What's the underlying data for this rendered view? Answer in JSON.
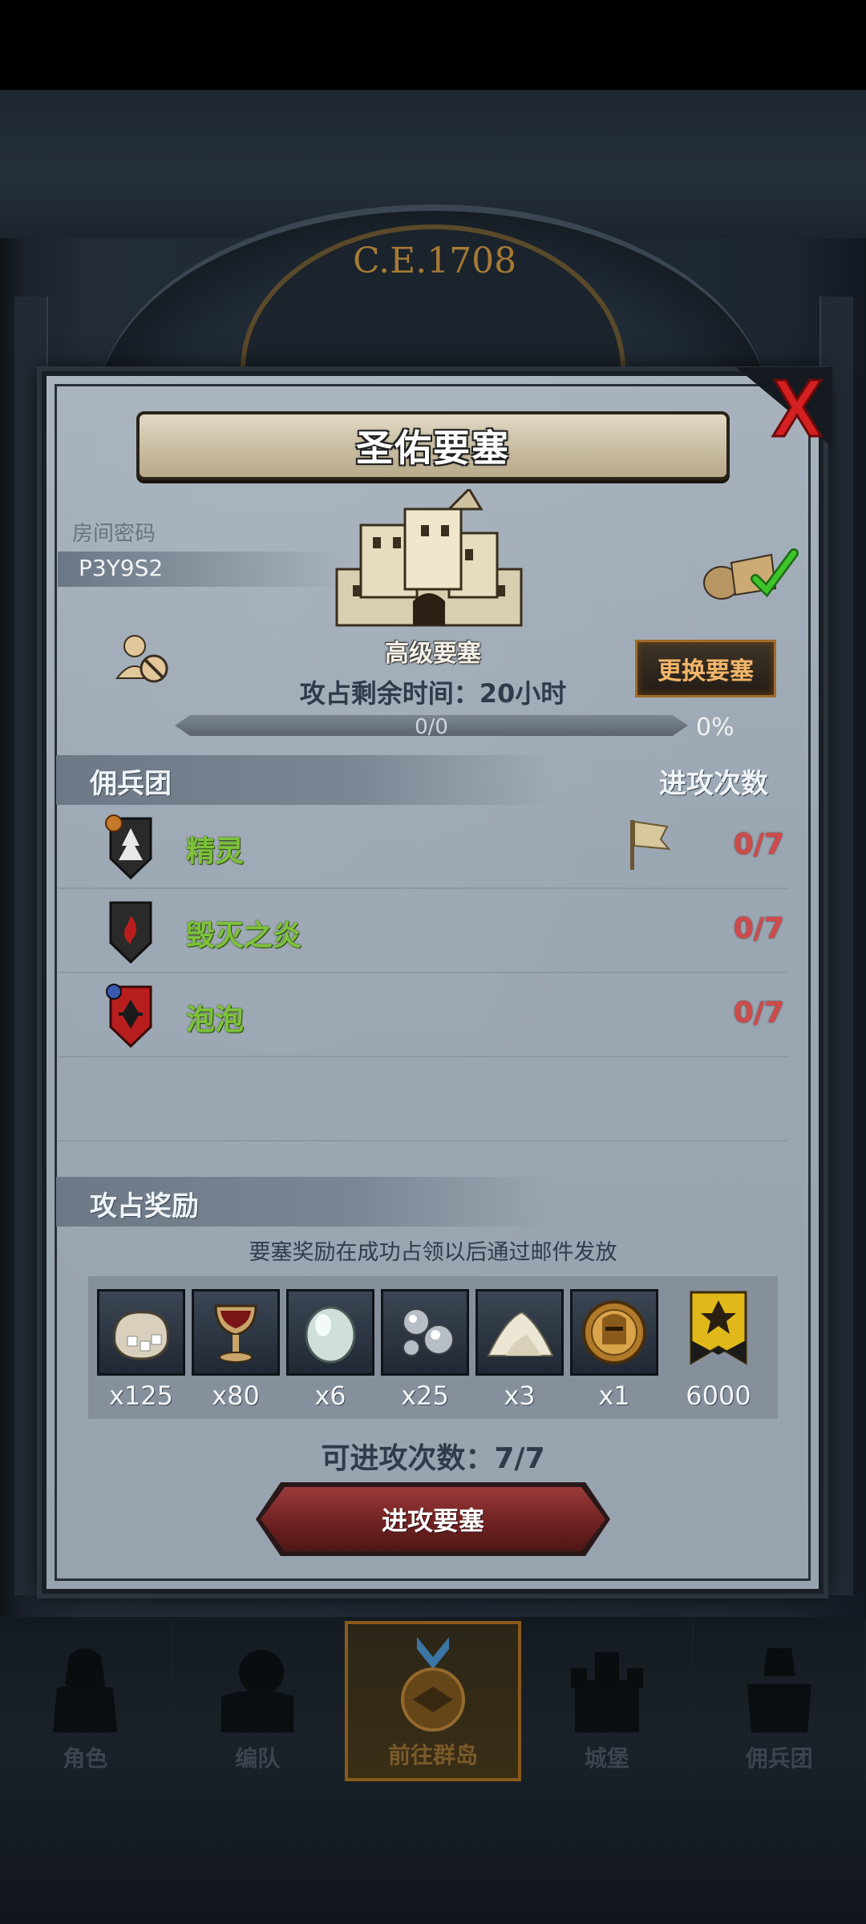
{
  "background": {
    "year": "C.E.1708"
  },
  "dialog": {
    "title": "圣佑要塞",
    "room_label": "房间密码",
    "room_code": "P3Y9S2",
    "fortress_level": "高级要塞",
    "change_button": "更换要塞",
    "remain_time": "攻占剩余时间：20小时",
    "progress": {
      "text": "0/0",
      "percent_label": "0%",
      "value": 0
    },
    "mercenary_header": "佣兵团",
    "attack_count_header": "进攻次数",
    "mercenaries": [
      {
        "name": "精灵",
        "count": "0/7",
        "flag": true
      },
      {
        "name": "毁灭之炎",
        "count": "0/7",
        "flag": false
      },
      {
        "name": "泡泡",
        "count": "0/7",
        "flag": false
      }
    ],
    "reward_header": "攻占奖励",
    "reward_note": "要塞奖励在成功占领以后通过邮件发放",
    "rewards": [
      {
        "icon": "ore-pouch-icon",
        "qty": "x125"
      },
      {
        "icon": "goblet-icon",
        "qty": "x80"
      },
      {
        "icon": "pearl-icon",
        "qty": "x6"
      },
      {
        "icon": "silver-orbs-icon",
        "qty": "x25"
      },
      {
        "icon": "salt-pile-icon",
        "qty": "x3"
      },
      {
        "icon": "knight-medal-icon",
        "qty": "x1"
      },
      {
        "icon": "rank-ribbon-icon",
        "qty": "6000"
      }
    ],
    "attacks_left": "可进攻次数：7/7",
    "attack_button": "进攻要塞"
  },
  "nav": {
    "items": [
      {
        "label": "角色",
        "icon": "knight-icon",
        "active": false
      },
      {
        "label": "编队",
        "icon": "formation-icon",
        "active": false
      },
      {
        "label": "前往群岛",
        "icon": "compass-icon",
        "active": true
      },
      {
        "label": "城堡",
        "icon": "castle-icon",
        "active": false
      },
      {
        "label": "佣兵团",
        "icon": "mercenary-icon",
        "active": false
      }
    ]
  },
  "colors": {
    "merc_name": "#7ec23a",
    "merc_count": "#d04a4a",
    "change_button_text": "#f2b56a",
    "attack_button": "#8a2c2c"
  }
}
